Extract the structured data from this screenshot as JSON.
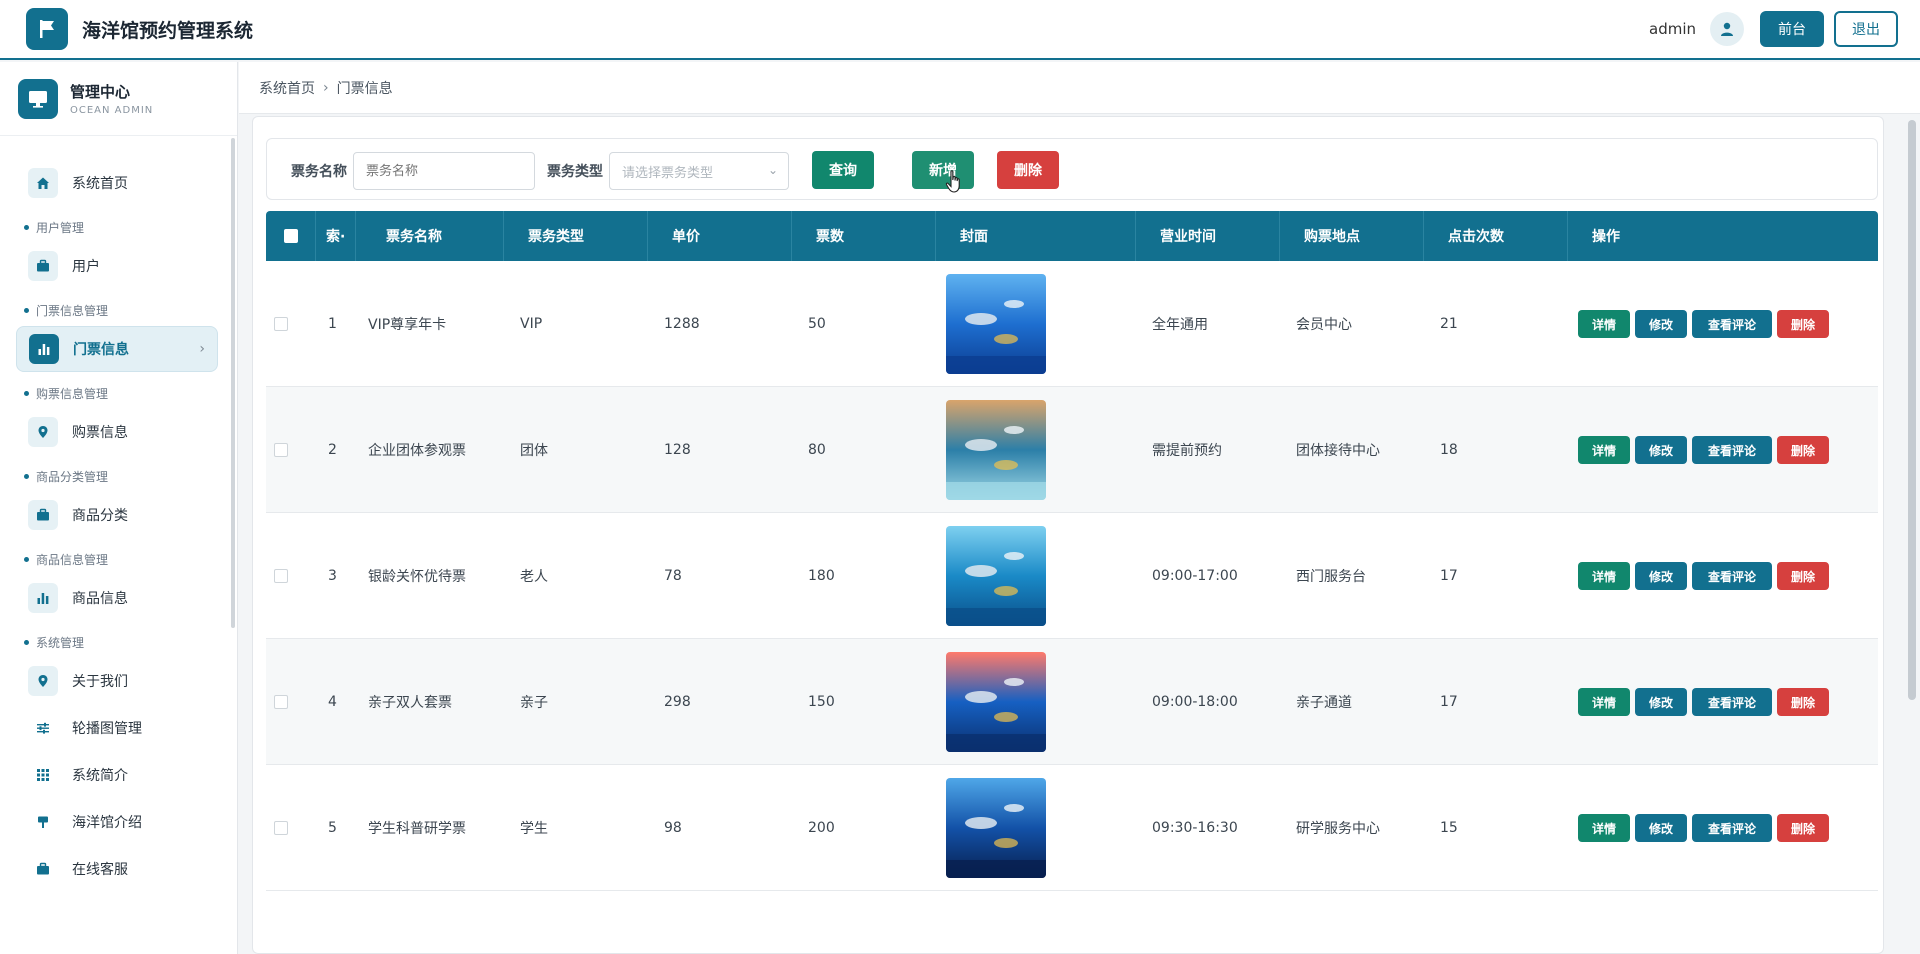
{
  "header": {
    "app_title": "海洋馆预约管理系统",
    "username": "admin",
    "front_label": "前台",
    "logout_label": "退出"
  },
  "sidebar": {
    "title": "管理中心",
    "subtitle": "OCEAN ADMIN",
    "home": "系统首页",
    "groups": [
      {
        "label": "用户管理",
        "items": [
          {
            "label": "用户",
            "icon": "briefcase-icon"
          }
        ]
      },
      {
        "label": "门票信息管理",
        "items": [
          {
            "label": "门票信息",
            "icon": "bar-chart-icon"
          }
        ]
      },
      {
        "label": "购票信息管理",
        "items": [
          {
            "label": "购票信息",
            "icon": "location-icon"
          }
        ]
      },
      {
        "label": "商品分类管理",
        "items": [
          {
            "label": "商品分类",
            "icon": "briefcase-icon"
          }
        ]
      },
      {
        "label": "商品信息管理",
        "items": [
          {
            "label": "商品信息",
            "icon": "bar-chart-icon"
          }
        ]
      },
      {
        "label": "系统管理",
        "items": [
          {
            "label": "关于我们",
            "icon": "location-icon"
          },
          {
            "label": "轮播图管理",
            "icon": "sliders-icon"
          },
          {
            "label": "系统简介",
            "icon": "grid-icon"
          },
          {
            "label": "海洋馆介绍",
            "icon": "sign-icon"
          },
          {
            "label": "在线客服",
            "icon": "briefcase-icon"
          }
        ]
      }
    ],
    "active_item": "门票信息"
  },
  "breadcrumb": {
    "home": "系统首页",
    "separator": "›",
    "current": "门票信息"
  },
  "search": {
    "name_label": "票务名称",
    "name_placeholder": "票务名称",
    "type_label": "票务类型",
    "type_placeholder": "请选择票务类型",
    "query_label": "查询",
    "add_label": "新增",
    "delete_label": "删除"
  },
  "table": {
    "columns": [
      "索·",
      "票务名称",
      "票务类型",
      "单价",
      "票数",
      "封面",
      "营业时间",
      "购票地点",
      "点击次数",
      "操作"
    ],
    "actions": {
      "detail": "详情",
      "edit": "修改",
      "review": "查看评论",
      "delete": "删除"
    },
    "rows": [
      {
        "idx": "1",
        "name": "VIP尊享年卡",
        "type": "VIP",
        "price": "1288",
        "count": "50",
        "hours": "全年通用",
        "place": "会员中心",
        "clicks": "21"
      },
      {
        "idx": "2",
        "name": "企业团体参观票",
        "type": "团体",
        "price": "128",
        "count": "80",
        "hours": "需提前预约",
        "place": "团体接待中心",
        "clicks": "18"
      },
      {
        "idx": "3",
        "name": "银龄关怀优待票",
        "type": "老人",
        "price": "78",
        "count": "180",
        "hours": "09:00-17:00",
        "place": "西门服务台",
        "clicks": "17"
      },
      {
        "idx": "4",
        "name": "亲子双人套票",
        "type": "亲子",
        "price": "298",
        "count": "150",
        "hours": "09:00-18:00",
        "place": "亲子通道",
        "clicks": "17"
      },
      {
        "idx": "5",
        "name": "学生科普研学票",
        "type": "学生",
        "price": "98",
        "count": "200",
        "hours": "09:30-16:30",
        "place": "研学服务中心",
        "clicks": "15"
      }
    ]
  },
  "colors": {
    "primary": "#12708f",
    "success": "#11876d",
    "danger": "#d6403e"
  }
}
